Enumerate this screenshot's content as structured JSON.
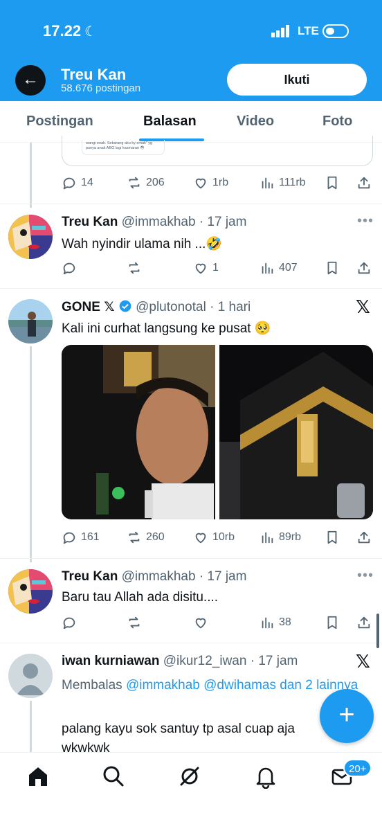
{
  "status_bar": {
    "time": "17.22",
    "network": "LTE"
  },
  "header": {
    "name": "Treu Kan",
    "post_count": "58.676 postingan",
    "follow_label": "Ikuti"
  },
  "tabs": [
    {
      "label": "Postingan",
      "active": false
    },
    {
      "label": "Balasan",
      "active": true
    },
    {
      "label": "Video",
      "active": false
    },
    {
      "label": "Foto",
      "active": false
    }
  ],
  "quoted_preview": {
    "text": "wangi enak. Sekarang aku ky emak\" yg punya anak ABG lagi kasmaran 😳"
  },
  "posts": [
    {
      "actions": {
        "replies": "14",
        "reposts": "206",
        "likes": "1rb",
        "views": "111rb"
      }
    },
    {
      "name": "Treu Kan",
      "handle": "@immakhab",
      "time": "17 jam",
      "text": "Wah nyindir ulama nih ...🤣",
      "actions": {
        "replies": "",
        "reposts": "",
        "likes": "1",
        "views": "407"
      }
    },
    {
      "name": "GONE",
      "handle": "@plutonotal",
      "time": "1 hari",
      "text": "Kali ini curhat langsung ke pusat 🥺",
      "actions": {
        "replies": "161",
        "reposts": "260",
        "likes": "10rb",
        "views": "89rb"
      }
    },
    {
      "name": "Treu Kan",
      "handle": "@immakhab",
      "time": "17 jam",
      "text": "Baru tau Allah ada disitu....",
      "actions": {
        "replies": "",
        "reposts": "",
        "likes": "",
        "views": "38"
      }
    },
    {
      "name": "iwan kurniawan",
      "handle": "@ikur12_iwan",
      "time": "17 jam",
      "reply_prefix": "Membalas",
      "reply_targets": "@immakhab @dwihamas dan 2 lainnya",
      "text_line1": "palang kayu sok santuy tp asal cuap aja",
      "text_line2": "wkwkwk"
    }
  ],
  "nav": {
    "messages_badge": "20+"
  },
  "colors": {
    "accent": "#1d9bf0",
    "text": "#0f1419",
    "muted": "#536471"
  }
}
